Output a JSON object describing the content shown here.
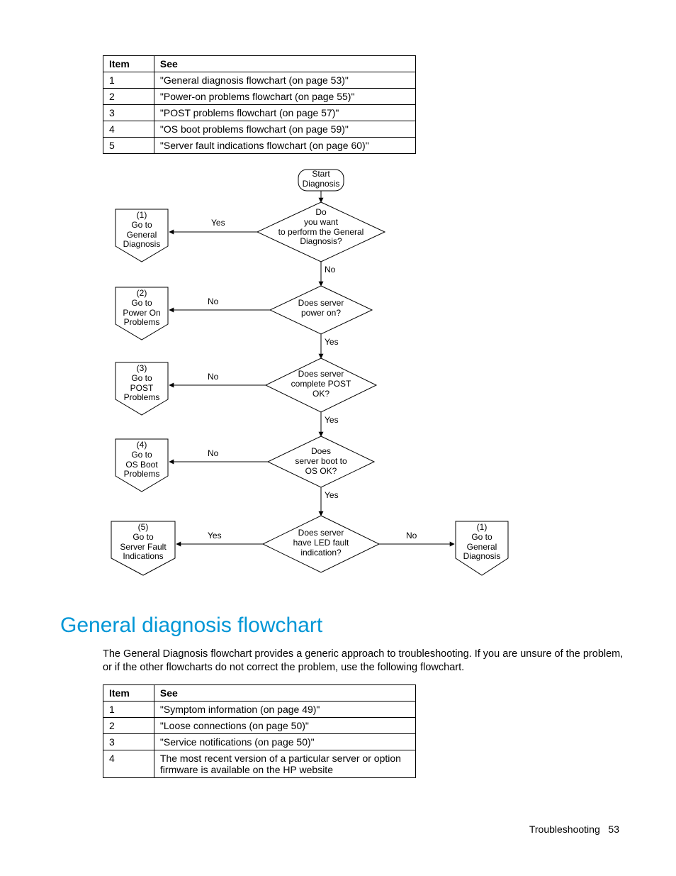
{
  "table1": {
    "headers": {
      "item": "Item",
      "see": "See"
    },
    "rows": [
      {
        "item": "1",
        "see": "\"General diagnosis flowchart (on page 53)\""
      },
      {
        "item": "2",
        "see": "\"Power-on problems flowchart (on page 55)\""
      },
      {
        "item": "3",
        "see": "\"POST problems flowchart (on page 57)\""
      },
      {
        "item": "4",
        "see": "\"OS boot problems flowchart (on page 59)\""
      },
      {
        "item": "5",
        "see": "\"Server fault indications flowchart (on page 60)\""
      }
    ]
  },
  "chart_data": {
    "type": "flowchart",
    "nodes": [
      {
        "id": "start",
        "kind": "terminator",
        "text": "Start\nDiagnosis"
      },
      {
        "id": "d1",
        "kind": "decision",
        "text": "Do\nyou want\nto perform the General\nDiagnosis?"
      },
      {
        "id": "d2",
        "kind": "decision",
        "text": "Does server\npower on?"
      },
      {
        "id": "d3",
        "kind": "decision",
        "text": "Does server\ncomplete POST\nOK?"
      },
      {
        "id": "d4",
        "kind": "decision",
        "text": "Does\nserver boot to\nOS OK?"
      },
      {
        "id": "d5",
        "kind": "decision",
        "text": "Does server\nhave LED fault\nindication?"
      },
      {
        "id": "r1",
        "kind": "offpage",
        "text": "(1)\nGo to\nGeneral\nDiagnosis"
      },
      {
        "id": "r2",
        "kind": "offpage",
        "text": "(2)\nGo to\nPower On\nProblems"
      },
      {
        "id": "r3",
        "kind": "offpage",
        "text": "(3)\nGo to\nPOST\nProblems"
      },
      {
        "id": "r4",
        "kind": "offpage",
        "text": "(4)\nGo to\nOS Boot\nProblems"
      },
      {
        "id": "r5",
        "kind": "offpage",
        "text": "(5)\nGo to\nServer Fault\nIndications"
      },
      {
        "id": "r1b",
        "kind": "offpage",
        "text": "(1)\nGo to\nGeneral\nDiagnosis"
      }
    ],
    "edges": [
      {
        "from": "start",
        "to": "d1",
        "label": ""
      },
      {
        "from": "d1",
        "to": "r1",
        "label": "Yes"
      },
      {
        "from": "d1",
        "to": "d2",
        "label": "No"
      },
      {
        "from": "d2",
        "to": "r2",
        "label": "No"
      },
      {
        "from": "d2",
        "to": "d3",
        "label": "Yes"
      },
      {
        "from": "d3",
        "to": "r3",
        "label": "No"
      },
      {
        "from": "d3",
        "to": "d4",
        "label": "Yes"
      },
      {
        "from": "d4",
        "to": "r4",
        "label": "No"
      },
      {
        "from": "d4",
        "to": "d5",
        "label": "Yes"
      },
      {
        "from": "d5",
        "to": "r5",
        "label": "Yes"
      },
      {
        "from": "d5",
        "to": "r1b",
        "label": "No"
      }
    ],
    "edge_labels": {
      "yes": "Yes",
      "no": "No"
    }
  },
  "section": {
    "title": "General diagnosis flowchart",
    "body": "The General Diagnosis flowchart provides a generic approach to troubleshooting. If you are unsure of the problem, or if the other flowcharts do not correct the problem, use the following flowchart."
  },
  "table2": {
    "headers": {
      "item": "Item",
      "see": "See"
    },
    "rows": [
      {
        "item": "1",
        "see": "\"Symptom information (on page 49)\""
      },
      {
        "item": "2",
        "see": "\"Loose connections (on page 50)\""
      },
      {
        "item": "3",
        "see": "\"Service notifications (on page 50)\""
      },
      {
        "item": "4",
        "see": "The most recent version of a particular server or option firmware is available on the HP website"
      }
    ]
  },
  "footer": {
    "section": "Troubleshooting",
    "page": "53"
  }
}
